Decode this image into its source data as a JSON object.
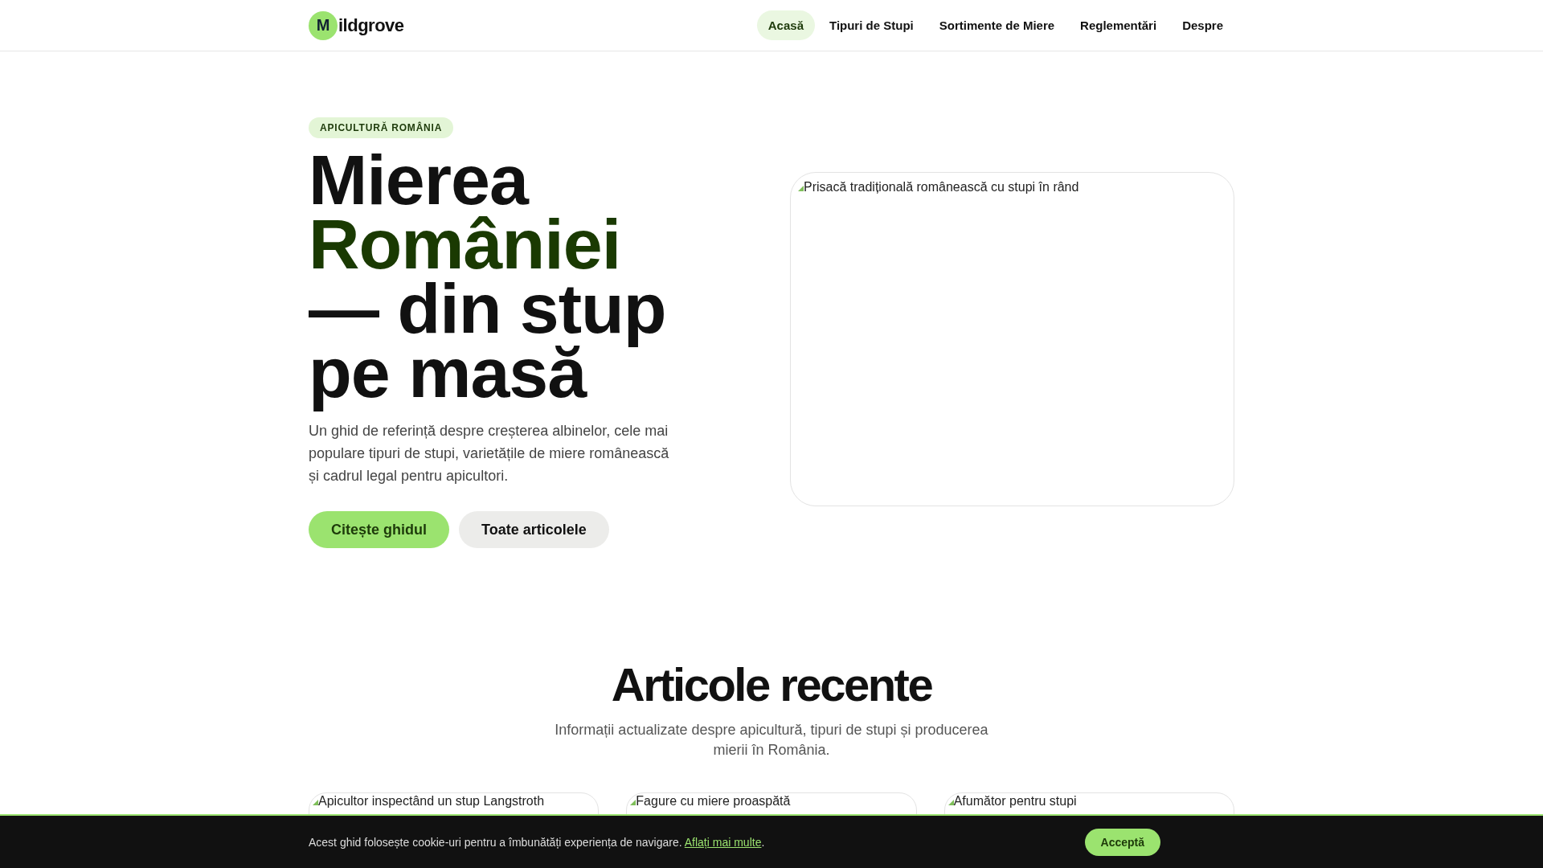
{
  "header": {
    "logo_mark": "M",
    "logo_text": "ildgrove",
    "nav": [
      {
        "label": "Acasă",
        "selected": true
      },
      {
        "label": "Tipuri de Stupi",
        "selected": false
      },
      {
        "label": "Sortimente de Miere",
        "selected": false
      },
      {
        "label": "Reglementări",
        "selected": false
      },
      {
        "label": "Despre",
        "selected": false
      }
    ]
  },
  "hero": {
    "tag": "APICULTURĂ ROMÂNIA",
    "heading": [
      {
        "text": "Mierea",
        "accent": false
      },
      {
        "text": "României",
        "accent": true
      },
      {
        "text": "— din stup pe masă",
        "accent": false
      }
    ],
    "intro": "Un ghid de referință despre creșterea albinelor, cele mai populare tipuri de stupi, varietățile de miere românească și cadrul legal pentru apicultori.",
    "buttons": [
      {
        "label": "Citește ghidul",
        "kind": "primary"
      },
      {
        "label": "Toate articolele",
        "kind": "secondary"
      }
    ],
    "image_alt": "Prisacă tradițională românească cu stupi în rând"
  },
  "recent": {
    "title": "Articole recente",
    "subtitle": "Informații actualizate despre apicultură, tipuri de stupi și producerea mierii în România.",
    "cards": [
      {
        "image_alt": "Apicultor inspectând un stup Langstroth"
      },
      {
        "image_alt": "Fagure cu miere proaspătă"
      },
      {
        "image_alt": "Afumător pentru stupi"
      }
    ]
  },
  "cookie_bar": {
    "text": "Acest ghid folosește cookie-uri pentru a îmbunătăți experiența de navigare.",
    "link": "Aflați mai multe",
    "after_link": ".",
    "button": "Acceptă"
  }
}
